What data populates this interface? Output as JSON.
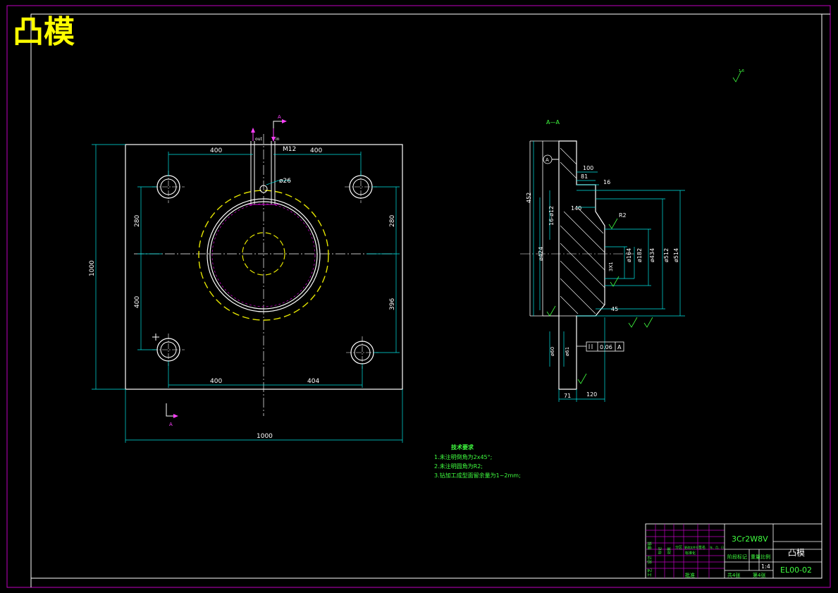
{
  "title": "凸模",
  "colors": {
    "background": "#000000",
    "frame": "#c000c0",
    "outline": "#ffffff",
    "dimension": "#00e5e5",
    "center": "#ffffff",
    "yellow": "#e6e600",
    "green": "#40ff40",
    "magenta": "#ff40ff"
  },
  "plan": {
    "dims": {
      "top_left": "400",
      "top_right": "400",
      "thread": "M12",
      "hole": "ø26",
      "left_upper": "280",
      "left_lower": "400",
      "right_upper": "280",
      "right_lower": "396",
      "height_total": "1000",
      "bottom_left": "400",
      "bottom_right": "404",
      "width_total": "1000",
      "pipe_left": "out",
      "pipe_right": "in"
    },
    "section_mark": "A"
  },
  "section": {
    "label": "A—A",
    "datum": "A",
    "roughness": "1.6",
    "dims": {
      "d100": "100",
      "d81": "81",
      "d16": "16",
      "d452": "452",
      "d16phi12": "16-ø12",
      "d140": "140",
      "r2": "R2",
      "phi424": "ø424",
      "phi164": "ø164",
      "phi182": "ø182",
      "phi434": "ø434",
      "phi512": "ø512",
      "phi514": "ø514",
      "d3x1": "3X1",
      "d45": "45",
      "d71": "71",
      "d120": "120",
      "tol": "0.06",
      "tol_datum": "A",
      "phi60": "ø60",
      "phi61": "ø61"
    }
  },
  "notes": {
    "heading": "技术要求",
    "lines": [
      "1.未注明倒角为2x45°;",
      "2.未注明圆角为R2;",
      "3.钻加工成型面留余量为1~2mm;"
    ]
  },
  "title_block": {
    "material": "3Cr2W8V",
    "part_name": "凸模",
    "scale": "1:4",
    "drawing_no": "EL00-02",
    "sheets_total": "共4张",
    "sheet_no": "第4张",
    "stage_mark": "阶段标记",
    "weight": "重量",
    "ratio": "比例",
    "approve": "批准",
    "standard": "标准化",
    "row_labels": [
      "设计",
      "审核",
      "工艺"
    ],
    "head_labels": [
      "标记",
      "处数",
      "分区",
      "更改文件号",
      "签名",
      "年、月、日"
    ]
  }
}
